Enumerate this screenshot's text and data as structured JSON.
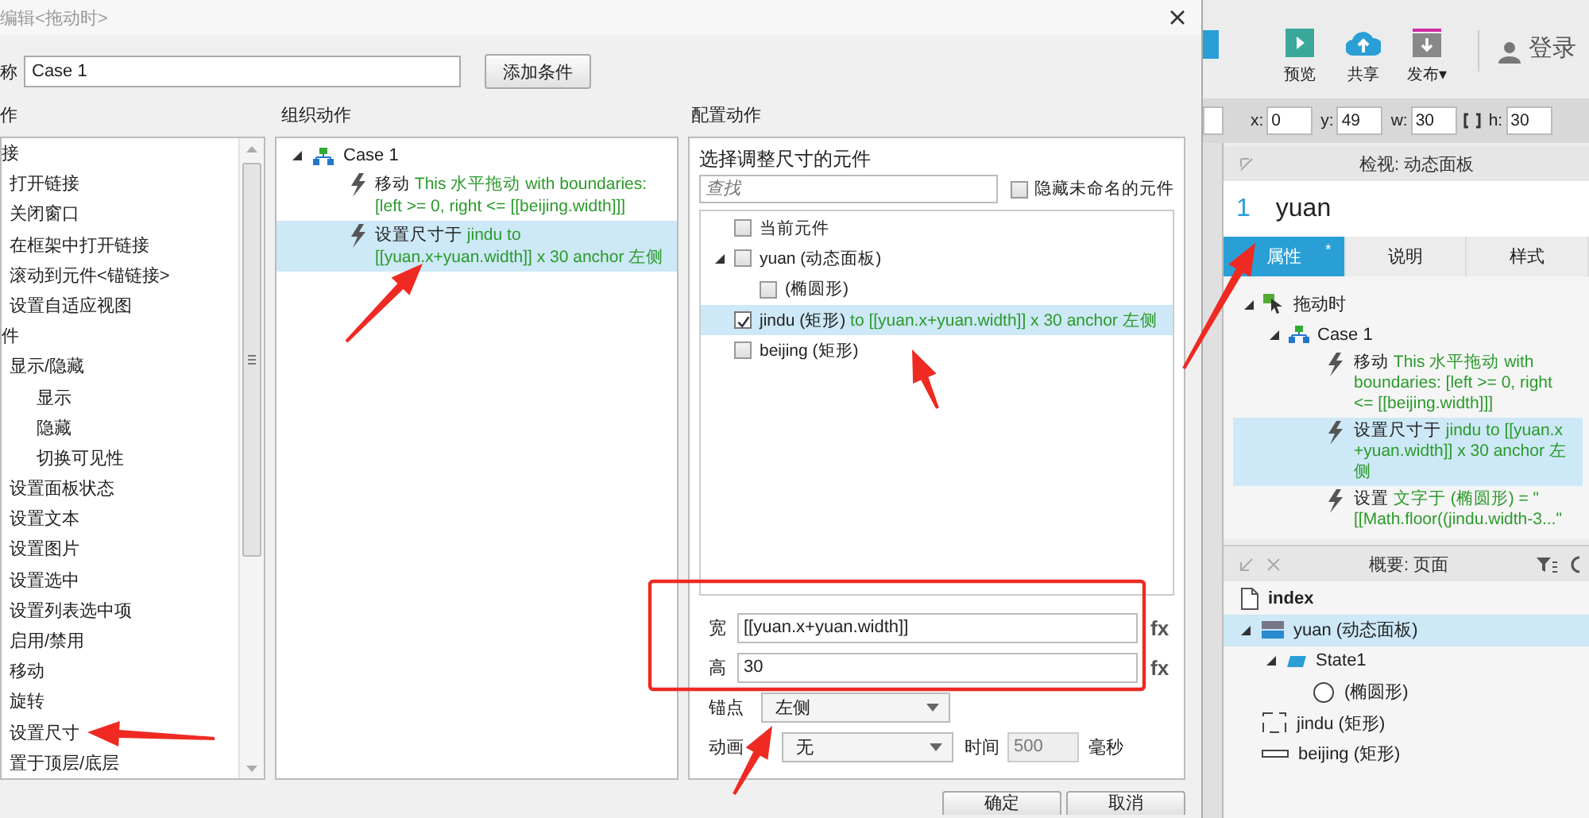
{
  "dialog": {
    "title": "编辑<拖动时>",
    "name_label": "称",
    "case_name": "Case 1",
    "add_condition": "添加条件",
    "actions_label": "作",
    "organize_label": "组织动作",
    "configure_label": "配置动作",
    "actions_list": [
      {
        "label": "接",
        "children": [
          {
            "label": "打开链接"
          },
          {
            "label": "关闭窗口"
          },
          {
            "label": "在框架中打开链接"
          },
          {
            "label": "滚动到元件<锚链接>"
          },
          {
            "label": "设置自适应视图"
          }
        ]
      },
      {
        "label": "件",
        "children": [
          {
            "label": "显示/隐藏",
            "children": [
              {
                "label": "显示"
              },
              {
                "label": "隐藏"
              },
              {
                "label": "切换可见性"
              }
            ]
          },
          {
            "label": "设置面板状态"
          },
          {
            "label": "设置文本"
          },
          {
            "label": "设置图片"
          },
          {
            "label": "设置选中"
          },
          {
            "label": "设置列表选中项"
          },
          {
            "label": "启用/禁用"
          },
          {
            "label": "移动"
          },
          {
            "label": "旋转"
          },
          {
            "label": "设置尺寸"
          },
          {
            "label": "置于顶层/底层"
          }
        ]
      }
    ],
    "organize": {
      "case": {
        "label": "Case 1",
        "expanded": true
      },
      "actions": [
        {
          "verb": "移动",
          "detail": "This 水平拖动 with boundaries: [left >= 0, right <= [[beijing.width]]]",
          "selected": false
        },
        {
          "verb": "设置尺寸于",
          "detail": "jindu to [[yuan.x+yuan.width]] x 30 anchor 左侧",
          "selected": true
        }
      ]
    },
    "configure": {
      "group_title": "选择调整尺寸的元件",
      "search_placeholder": "查找",
      "hide_unnamed": {
        "label": "隐藏未命名的元件",
        "checked": false
      },
      "widgets": [
        {
          "label": "当前元件",
          "checked": false,
          "selected": false
        },
        {
          "label": "yuan (动态面板)",
          "checked": false,
          "selected": false,
          "expanded": true,
          "children": [
            {
              "label": "(椭圆形)",
              "checked": false,
              "selected": false
            }
          ]
        },
        {
          "label": "jindu (矩形)",
          "detail": "to [[yuan.x+yuan.width]] x 30 anchor 左侧",
          "checked": true,
          "selected": true
        },
        {
          "label": "beijing (矩形)",
          "checked": false,
          "selected": false
        }
      ],
      "width": {
        "label": "宽",
        "value": "[[yuan.x+yuan.width]]",
        "fx": "fx"
      },
      "height": {
        "label": "高",
        "value": "30",
        "fx": "fx"
      },
      "anchor": {
        "label": "锚点",
        "value": "左侧"
      },
      "animation": {
        "label": "动画",
        "value": "无"
      },
      "time": {
        "label": "时间",
        "value": "500",
        "disabled": true,
        "unit": "毫秒"
      }
    },
    "buttons": [
      "确定",
      "取消"
    ]
  },
  "app": {
    "tools": [
      {
        "label": "预览",
        "kind": "preview"
      },
      {
        "label": "共享",
        "kind": "share"
      },
      {
        "label": "发布",
        "kind": "publish",
        "caret": "▾"
      }
    ],
    "login": "登录",
    "geometry": [
      {
        "label": "x:",
        "value": "0"
      },
      {
        "label": "y:",
        "value": "49"
      },
      {
        "label": "w:",
        "value": "30"
      },
      {
        "label": "h:",
        "value": "30"
      }
    ],
    "inspector": {
      "title": "检视: 动态面板",
      "number": "1",
      "name": "yuan",
      "tabs": [
        {
          "label": "属性",
          "selected": true,
          "badge": "*"
        },
        {
          "label": "说明",
          "selected": false
        },
        {
          "label": "样式",
          "selected": false
        }
      ],
      "event": {
        "label": "拖动时",
        "expanded": true,
        "case": {
          "label": "Case 1",
          "expanded": true
        },
        "actions": [
          {
            "verb": "移动",
            "detail": "This 水平拖动 with boundaries: [left >= 0, right <= [[beijing.width]]]",
            "selected": false
          },
          {
            "verb": "设置尺寸于",
            "detail": "jindu to [[yuan.x +yuan.width]] x 30 anchor 左侧",
            "selected": true
          },
          {
            "verb": "设置",
            "detail": "文字于 (椭圆形) = \"[[Math.floor((jindu.width-3...\"",
            "selected": false
          }
        ]
      }
    },
    "outline": {
      "title": "概要: 页面",
      "page": "index",
      "nodes": [
        {
          "label": "yuan (动态面板)",
          "kind": "panel",
          "expanded": true,
          "selected": true,
          "children": [
            {
              "label": "State1",
              "kind": "state",
              "expanded": true,
              "selected": false,
              "children": [
                {
                  "label": "(椭圆形)",
                  "kind": "ellipse",
                  "selected": false
                }
              ]
            }
          ]
        },
        {
          "label": "jindu (矩形)",
          "kind": "rect",
          "selected": false
        },
        {
          "label": "beijing (矩形)",
          "kind": "bar",
          "selected": false
        }
      ]
    }
  }
}
